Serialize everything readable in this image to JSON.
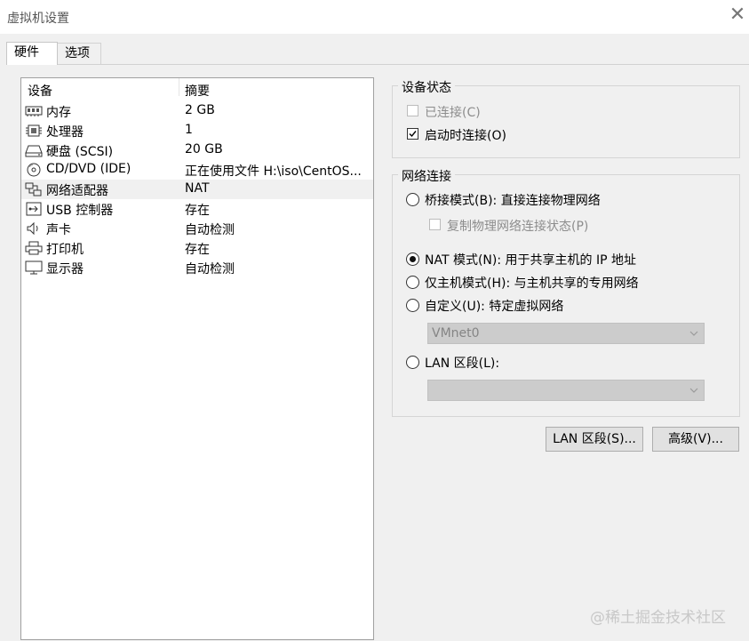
{
  "window": {
    "title": "虚拟机设置",
    "close_glyph": "✕"
  },
  "tabs": [
    {
      "label": "硬件",
      "active": true
    },
    {
      "label": "选项",
      "active": false
    }
  ],
  "device_list": {
    "columns": [
      "设备",
      "摘要"
    ],
    "rows": [
      {
        "icon": "memory-icon",
        "name": "内存",
        "summary": "2 GB",
        "selected": false
      },
      {
        "icon": "processor-icon",
        "name": "处理器",
        "summary": "1",
        "selected": false
      },
      {
        "icon": "hard-disk-icon",
        "name": "硬盘 (SCSI)",
        "summary": "20 GB",
        "selected": false
      },
      {
        "icon": "cd-dvd-icon",
        "name": "CD/DVD (IDE)",
        "summary": "正在使用文件 H:\\iso\\CentOS...",
        "selected": false
      },
      {
        "icon": "network-adapter-icon",
        "name": "网络适配器",
        "summary": "NAT",
        "selected": true
      },
      {
        "icon": "usb-icon",
        "name": "USB 控制器",
        "summary": "存在",
        "selected": false
      },
      {
        "icon": "speaker-icon",
        "name": "声卡",
        "summary": "自动检测",
        "selected": false
      },
      {
        "icon": "printer-icon",
        "name": "打印机",
        "summary": "存在",
        "selected": false
      },
      {
        "icon": "monitor-icon",
        "name": "显示器",
        "summary": "自动检测",
        "selected": false
      }
    ]
  },
  "device_status": {
    "title": "设备状态",
    "connected": {
      "label": "已连接(C)",
      "checked": false,
      "enabled": false
    },
    "connect_on_start": {
      "label": "启动时连接(O)",
      "checked": true,
      "enabled": true
    }
  },
  "network": {
    "title": "网络连接",
    "bridged": {
      "label": "桥接模式(B): 直接连接物理网络",
      "selected": false
    },
    "replicate": {
      "label": "复制物理网络连接状态(P)",
      "checked": false,
      "enabled": false
    },
    "nat": {
      "label": "NAT 模式(N): 用于共享主机的 IP 地址",
      "selected": true
    },
    "host_only": {
      "label": "仅主机模式(H): 与主机共享的专用网络",
      "selected": false
    },
    "custom": {
      "label": "自定义(U): 特定虚拟网络",
      "selected": false
    },
    "custom_select": {
      "value": "VMnet0"
    },
    "lan_segment": {
      "label": "LAN 区段(L):",
      "selected": false
    },
    "lan_select": {
      "value": ""
    }
  },
  "buttons": {
    "lan_segments": "LAN 区段(S)...",
    "advanced": "高级(V)..."
  },
  "watermark": "@稀土掘金技术社区"
}
